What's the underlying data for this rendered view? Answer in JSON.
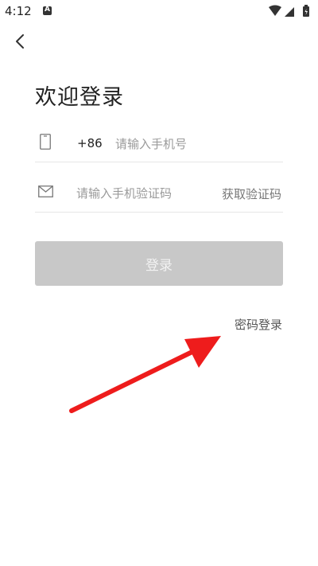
{
  "status_bar": {
    "time": "4:12"
  },
  "page": {
    "title": "欢迎登录",
    "country_code": "+86",
    "phone_placeholder": "请输入手机号",
    "code_placeholder": "请输入手机验证码",
    "get_code_label": "获取验证码",
    "login_label": "登录",
    "password_login_label": "密码登录"
  },
  "icons": {
    "back": "back-arrow-icon",
    "phone": "phone-icon",
    "mail": "mail-icon",
    "annotation": "red-arrow-annotation"
  },
  "colors": {
    "login_button_disabled": "#c8c8c8",
    "annotation_arrow": "#ee1c1c"
  }
}
